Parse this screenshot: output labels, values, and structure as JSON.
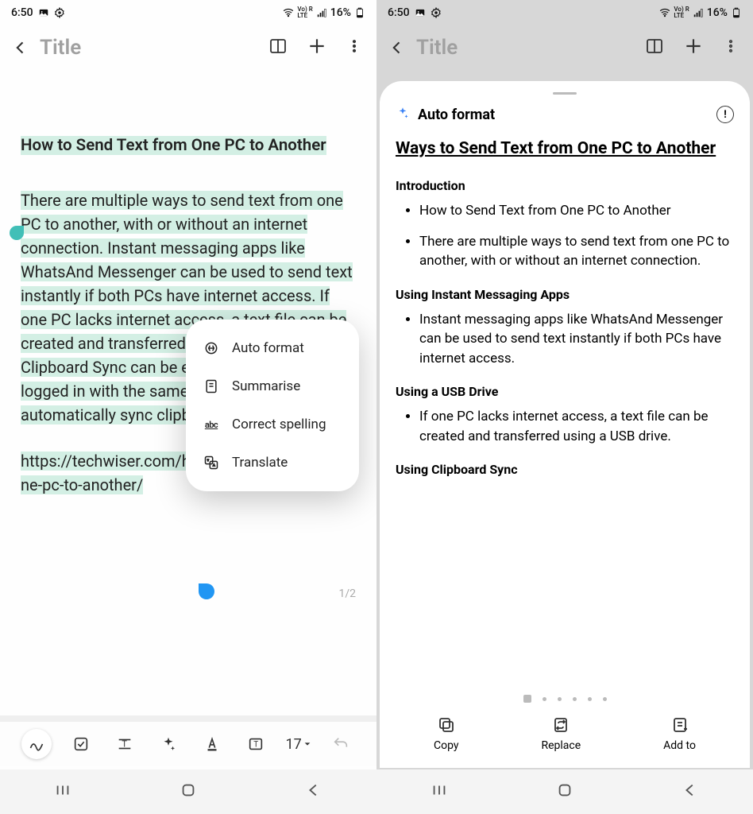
{
  "status": {
    "time": "6:50",
    "battery": "16%"
  },
  "header": {
    "title_placeholder": "Title"
  },
  "note": {
    "heading": "How to Send Text from One PC to Another",
    "body": "There are multiple ways to send text from one PC to another, with or without an internet connection. Instant messaging apps like WhatsAnd Messenger can be used to send text instantly if both PCs have internet access. If one PC lacks internet access, a text file can be created and transferred using a USB drive. Clipboard Sync can be enabled on both PCs logged in with the same Microsoft account to automatically sync clipboard content.",
    "url": "https://techwiser.com/how-to-send-text-from-one-pc-to-another/",
    "page_indicator": "1/2"
  },
  "popup": {
    "items": [
      {
        "label": "Auto format"
      },
      {
        "label": "Summarise"
      },
      {
        "label": "Correct spelling"
      },
      {
        "label": "Translate"
      }
    ]
  },
  "toolbar": {
    "font_size": "17"
  },
  "sheet": {
    "title": "Auto format",
    "heading": "Ways to Send Text from One PC to Another",
    "sections": [
      {
        "title": "Introduction",
        "bullets": [
          "How to Send Text from One PC to Another",
          "There are multiple ways to send text from one PC to another, with or without an internet connection."
        ]
      },
      {
        "title": "Using Instant Messaging Apps",
        "bullets": [
          "Instant messaging apps like WhatsAnd Messenger can be used to send text instantly if both PCs have internet access."
        ]
      },
      {
        "title": "Using a USB Drive",
        "bullets": [
          "If one PC lacks internet access, a text file can be created and transferred using a USB drive."
        ]
      },
      {
        "title": "Using Clipboard Sync",
        "bullets": []
      }
    ],
    "actions": {
      "copy": "Copy",
      "replace": "Replace",
      "addto": "Add to"
    }
  }
}
